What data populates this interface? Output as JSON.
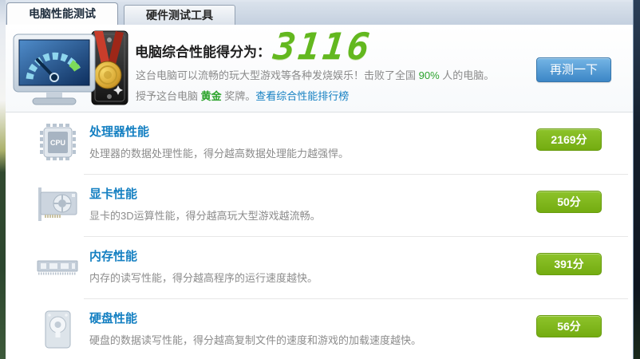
{
  "tabs": [
    {
      "label": "电脑性能测试",
      "active": true
    },
    {
      "label": "硬件测试工具",
      "active": false
    }
  ],
  "header": {
    "title": "电脑综合性能得分为：",
    "score": "3116",
    "desc_pre": "这台电脑可以流畅的玩大型游戏等各种发烧娱乐！击败了全国 ",
    "desc_percent": "90%",
    "desc_post": " 人的电脑。",
    "award_pre": "授予这台电脑 ",
    "award_medal": "黄金",
    "award_post": " 奖牌。",
    "ranking_link": "查看综合性能排行榜",
    "retest_button": "再测一下",
    "hero_icon": "speedometer-pc-gold-medal-icon"
  },
  "rows": [
    {
      "icon": "cpu-icon",
      "title": "处理器性能",
      "desc": "处理器的数据处理性能，得分越高数据处理能力越强悍。",
      "score": "2169分"
    },
    {
      "icon": "gpu-icon",
      "title": "显卡性能",
      "desc": "显卡的3D运算性能，得分越高玩大型游戏越流畅。",
      "score": "50分"
    },
    {
      "icon": "memory-icon",
      "title": "内存性能",
      "desc": "内存的读写性能，得分越高程序的运行速度越快。",
      "score": "391分"
    },
    {
      "icon": "disk-icon",
      "title": "硬盘性能",
      "desc": "硬盘的数据读写性能，得分越高复制文件的速度和游戏的加载速度越快。",
      "score": "56分"
    }
  ],
  "colors": {
    "accent_blue": "#1580c2",
    "badge_green": "#7cb31c",
    "score_green": "#63b81f",
    "percent_green": "#2ba32b",
    "button_blue": "#4b97d4"
  }
}
